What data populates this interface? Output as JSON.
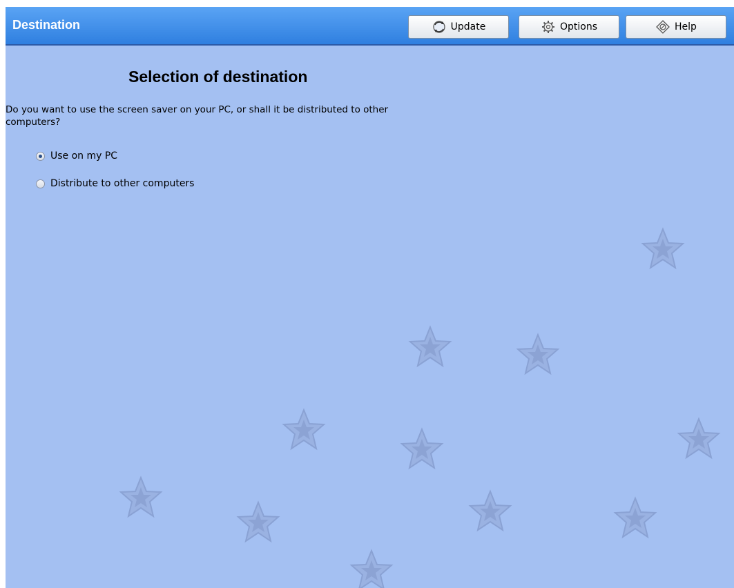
{
  "header": {
    "title": "Destination",
    "buttons": [
      {
        "label": "Update",
        "icon": "update-icon"
      },
      {
        "label": "Options",
        "icon": "options-icon"
      },
      {
        "label": "Help",
        "icon": "help-icon"
      }
    ]
  },
  "main": {
    "heading": "Selection of destination",
    "question": "Do you want to use the screen saver on your PC, or shall it be distributed to other computers?",
    "options": [
      {
        "label": "Use on my PC",
        "selected": true
      },
      {
        "label": "Distribute to other computers",
        "selected": false
      }
    ]
  },
  "colors": {
    "background": "#a4c0f2",
    "header": "#2f7fe0",
    "star": "#8ea6d6"
  },
  "decoration": {
    "icon": "star-icon"
  }
}
